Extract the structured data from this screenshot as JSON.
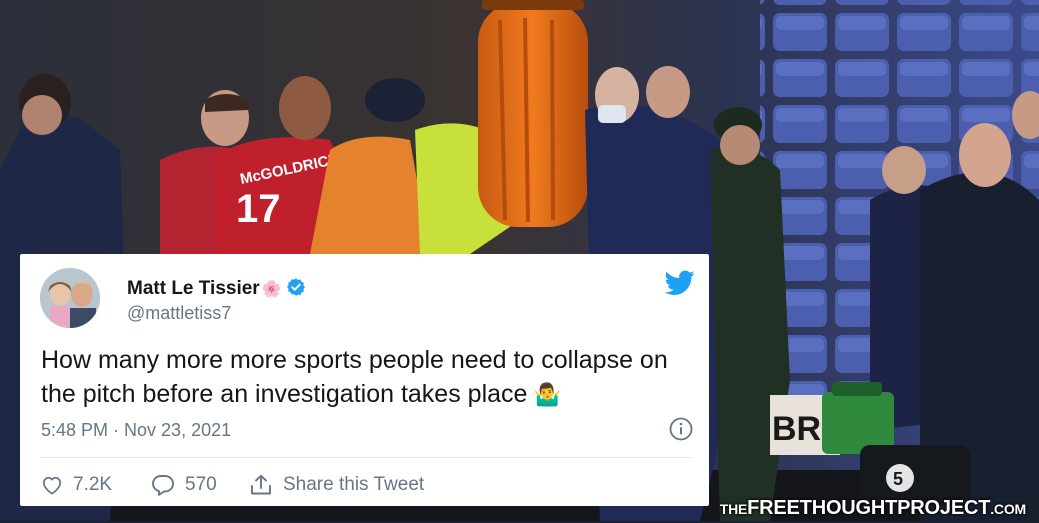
{
  "tweet": {
    "display_name": "Matt Le Tissier",
    "name_emoji": "🌸",
    "handle": "@mattletiss7",
    "text": "How many more more sports people need to collapse on the pitch before an investigation takes place",
    "text_emoji": "🤷‍♂️",
    "timestamp": "5:48 PM · Nov 23, 2021",
    "likes": "7.2K",
    "replies": "570",
    "share_label": "Share this Tweet",
    "brand_color": "#1da1f2"
  },
  "photo": {
    "jersey_name": "McGOLDRICK",
    "jersey_number": "17",
    "ad_board_text": "BRIT",
    "bag_number": "5"
  },
  "watermark": {
    "prefix": "THE",
    "main": "FREETHOUGHTPROJECT",
    "suffix": ".COM"
  }
}
